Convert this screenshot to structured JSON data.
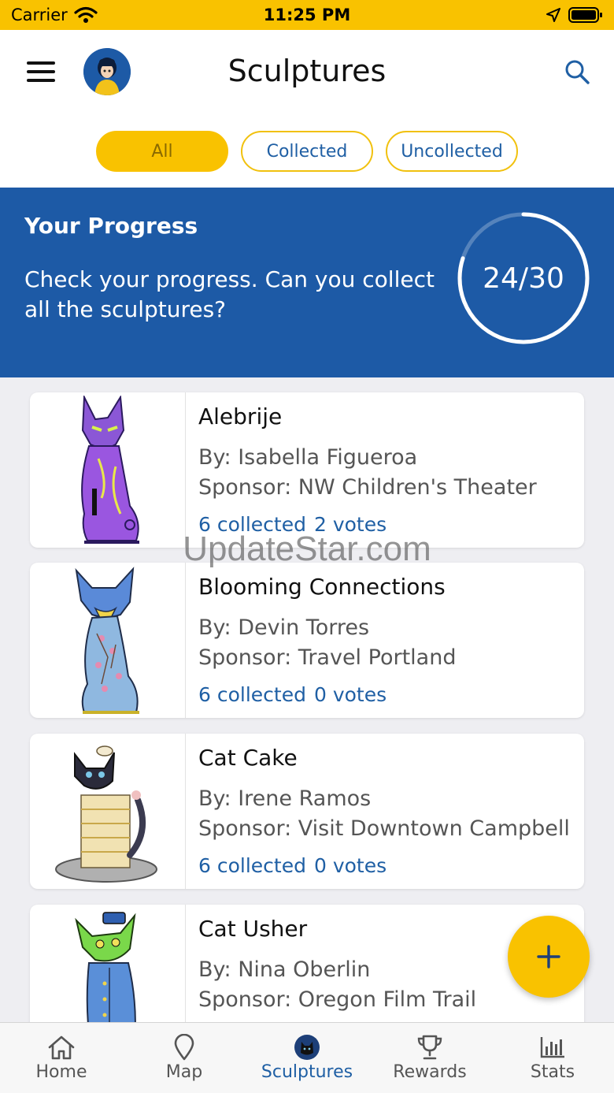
{
  "status_bar": {
    "carrier": "Carrier",
    "time": "11:25 PM"
  },
  "header": {
    "title": "Sculptures"
  },
  "filters": [
    {
      "label": "All",
      "active": true
    },
    {
      "label": "Collected",
      "active": false
    },
    {
      "label": "Uncollected",
      "active": false
    }
  ],
  "progress": {
    "title": "Your Progress",
    "text": "Check your progress. Can you collect all the sculptures?",
    "label": "24/30",
    "collected": 24,
    "total": 30
  },
  "sculptures": [
    {
      "name": "Alebrije",
      "artist": "By: Isabella Figueroa",
      "sponsor": "Sponsor: NW Children's Theater",
      "collected": "6 collected",
      "votes": "2 votes"
    },
    {
      "name": "Blooming Connections",
      "artist": "By: Devin Torres",
      "sponsor": "Sponsor: Travel Portland",
      "collected": "6 collected",
      "votes": "0 votes"
    },
    {
      "name": "Cat Cake",
      "artist": "By: Irene Ramos",
      "sponsor": "Sponsor: Visit Downtown Campbell",
      "collected": "6 collected",
      "votes": "0 votes"
    },
    {
      "name": "Cat Usher",
      "artist": "By: Nina Oberlin",
      "sponsor": "Sponsor: Oregon Film Trail",
      "collected": "",
      "votes": ""
    }
  ],
  "watermark": "UpdateStar.com",
  "tabs": [
    {
      "label": "Home",
      "icon": "home-icon",
      "active": false
    },
    {
      "label": "Map",
      "icon": "map-pin-icon",
      "active": false
    },
    {
      "label": "Sculptures",
      "icon": "cat-icon",
      "active": true
    },
    {
      "label": "Rewards",
      "icon": "trophy-icon",
      "active": false
    },
    {
      "label": "Stats",
      "icon": "bar-chart-icon",
      "active": false
    }
  ],
  "colors": {
    "accent": "#f9c200",
    "primary": "#1d5aa6",
    "link": "#1f5fa4"
  }
}
